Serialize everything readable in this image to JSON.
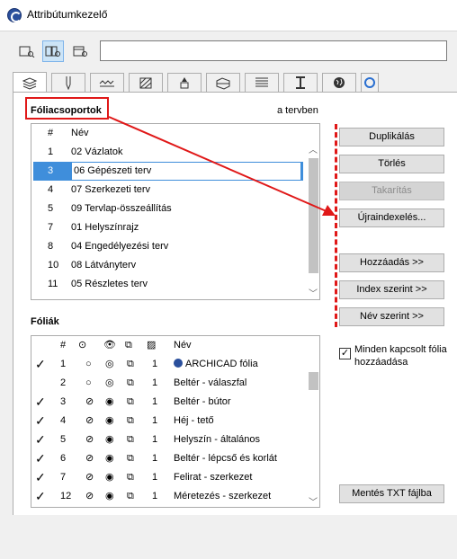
{
  "window": {
    "title": "Attribútumkezelő"
  },
  "search": {
    "value": ""
  },
  "view_buttons": [
    "list-view-icon",
    "split-view-icon",
    "detail-view-icon"
  ],
  "tabs": [
    "layers-icon",
    "pen-icon",
    "linetype-icon",
    "fill-icon",
    "surface-icon",
    "composite-icon",
    "profile-icon",
    "zone-icon",
    "globe-icon",
    "more-icon"
  ],
  "combinations": {
    "title": "Fóliacsoportok",
    "in_plan_label": "a tervben",
    "headers": {
      "num": "#",
      "name": "Név"
    },
    "rows": [
      {
        "num": "1",
        "name": "02 Vázlatok"
      },
      {
        "num": "3",
        "name": "06 Gépészeti terv",
        "selected": true
      },
      {
        "num": "4",
        "name": "07 Szerkezeti terv"
      },
      {
        "num": "5",
        "name": "09 Tervlap-összeállítás"
      },
      {
        "num": "7",
        "name": "01 Helyszínrajz"
      },
      {
        "num": "8",
        "name": "04 Engedélyezési terv"
      },
      {
        "num": "10",
        "name": "08 Látványterv"
      },
      {
        "num": "11",
        "name": "05 Részletes terv"
      }
    ]
  },
  "buttons": {
    "duplicate": "Duplikálás",
    "delete": "Törlés",
    "purge": "Takarítás",
    "reindex": "Újraindexelés...",
    "add": "Hozzáadás >>",
    "by_index": "Index szerint >>",
    "by_name": "Név szerint >>",
    "save_txt": "Mentés TXT fájlba"
  },
  "layers": {
    "title": "Fóliák",
    "headers": {
      "num": "#",
      "name": "Név"
    },
    "rows": [
      {
        "checked": true,
        "num": "1",
        "pen": "1",
        "name": "ARCHICAD fólia",
        "globe": true
      },
      {
        "checked": false,
        "num": "2",
        "pen": "1",
        "name": "Beltér - válaszfal"
      },
      {
        "checked": true,
        "num": "3",
        "pen": "1",
        "name": "Beltér - bútor"
      },
      {
        "checked": true,
        "num": "4",
        "pen": "1",
        "name": "Héj - tető"
      },
      {
        "checked": true,
        "num": "5",
        "pen": "1",
        "name": "Helyszín - általános"
      },
      {
        "checked": true,
        "num": "6",
        "pen": "1",
        "name": "Beltér - lépcső és korlát"
      },
      {
        "checked": true,
        "num": "7",
        "pen": "1",
        "name": "Felirat - szerkezet"
      },
      {
        "checked": true,
        "num": "12",
        "pen": "1",
        "name": "Méretezés - szerkezet"
      }
    ]
  },
  "add_all_checkbox": {
    "checked": true,
    "label": "Minden kapcsolt fólia hozzáadása"
  },
  "accent": {
    "selection": "#3f8edb",
    "annotation": "#e01818"
  }
}
